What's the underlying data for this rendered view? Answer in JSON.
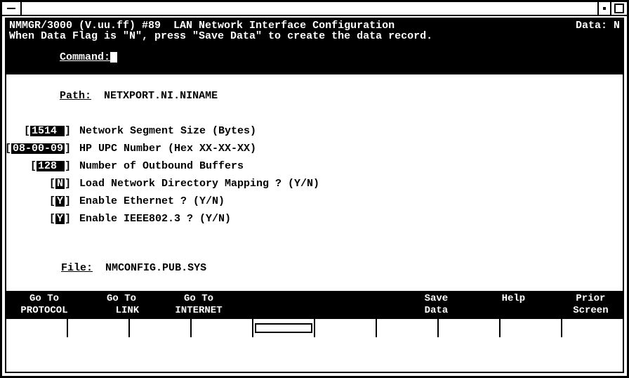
{
  "header": {
    "title_left": "NMMGR/3000 (V.uu.ff) #89  LAN Network Interface Configuration",
    "title_right": "Data: N",
    "subtitle": "When Data Flag is \"N\", press \"Save Data\" to create the data record.",
    "command_label": "Command:"
  },
  "path": {
    "label": "Path:",
    "value": "NETXPORT.NI.NINAME"
  },
  "fields": [
    {
      "value": "1514 ",
      "desc": "Network Segment Size (Bytes)"
    },
    {
      "value": "08-00-09",
      "desc": "HP UPC Number (Hex XX-XX-XX)"
    },
    {
      "value": "128 ",
      "desc": "Number of Outbound Buffers"
    },
    {
      "value": "N",
      "desc": "Load Network Directory Mapping ? (Y/N)"
    },
    {
      "value": "Y",
      "desc": "Enable Ethernet ? (Y/N)"
    },
    {
      "value": "Y",
      "desc": "Enable IEEE802.3 ? (Y/N)"
    }
  ],
  "file": {
    "label": "File:",
    "value": "NMCONFIG.PUB.SYS"
  },
  "fnkeys": [
    " Go To \nPROTOCOL",
    " Go To \n  LINK",
    " Go To \nINTERNET",
    "",
    "",
    "  Save\n  Data",
    "  Help",
    "  Prior\n  Screen"
  ]
}
